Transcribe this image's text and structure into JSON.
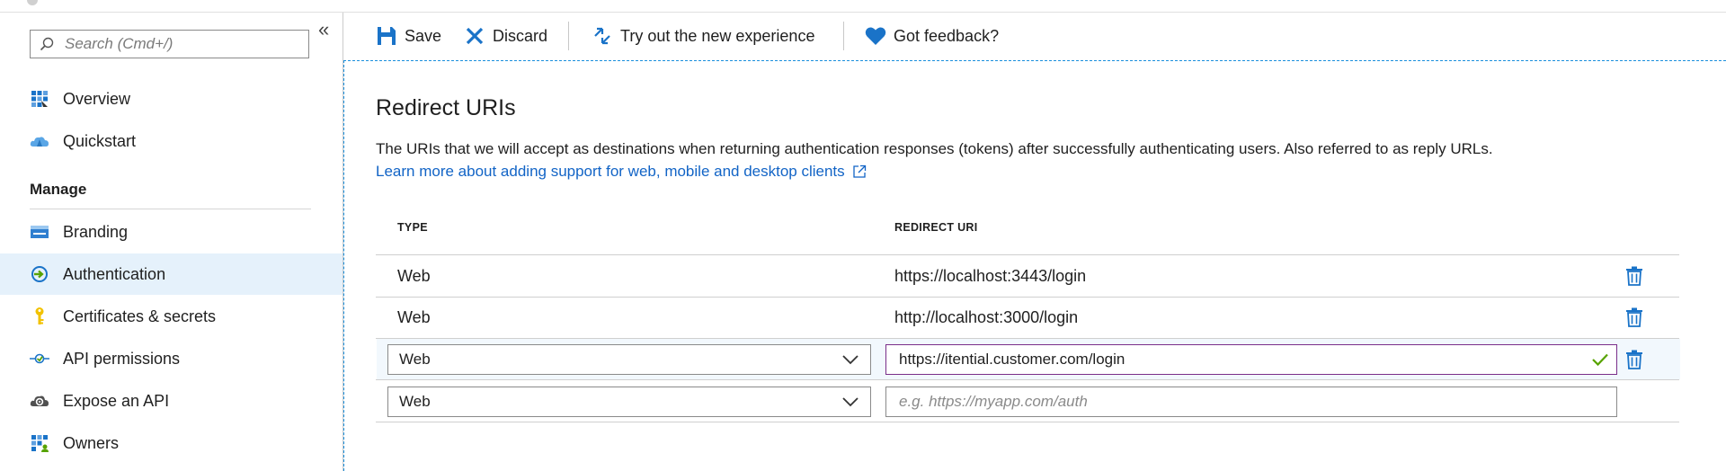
{
  "sidebar": {
    "search_placeholder": "Search (Cmd+/)",
    "collapse_glyph": "«",
    "top_items": [
      {
        "label": "Overview",
        "icon": "overview-grid-icon"
      },
      {
        "label": "Quickstart",
        "icon": "quickstart-cloud-icon"
      }
    ],
    "manage_title": "Manage",
    "manage_items": [
      {
        "label": "Branding",
        "icon": "branding-card-icon"
      },
      {
        "label": "Authentication",
        "icon": "authentication-icon",
        "active": true
      },
      {
        "label": "Certificates & secrets",
        "icon": "key-icon"
      },
      {
        "label": "API permissions",
        "icon": "api-permissions-icon"
      },
      {
        "label": "Expose an API",
        "icon": "cloud-gear-icon"
      },
      {
        "label": "Owners",
        "icon": "owners-grid-icon"
      }
    ]
  },
  "toolbar": {
    "save_label": "Save",
    "discard_label": "Discard",
    "try_label": "Try out the new experience",
    "feedback_label": "Got feedback?"
  },
  "main": {
    "title": "Redirect URIs",
    "description": "The URIs that we will accept as destinations when returning authentication responses (tokens) after successfully authenticating users. Also referred to as reply URLs.",
    "learn_more": "Learn more about adding support for web, mobile and desktop clients",
    "table": {
      "col_type": "TYPE",
      "col_uri": "REDIRECT URI",
      "rows": [
        {
          "type": "Web",
          "uri": "https://localhost:3443/login"
        },
        {
          "type": "Web",
          "uri": "http://localhost:3000/login"
        }
      ],
      "edit_row": {
        "type": "Web",
        "uri": "https://itential.customer.com/login"
      },
      "new_row": {
        "type": "Web",
        "uri_placeholder": "e.g. https://myapp.com/auth"
      }
    }
  },
  "colors": {
    "accent": "#0078d4",
    "link": "#1264c6",
    "active_bg": "#e5f1fb",
    "valid_check": "#57a300"
  }
}
